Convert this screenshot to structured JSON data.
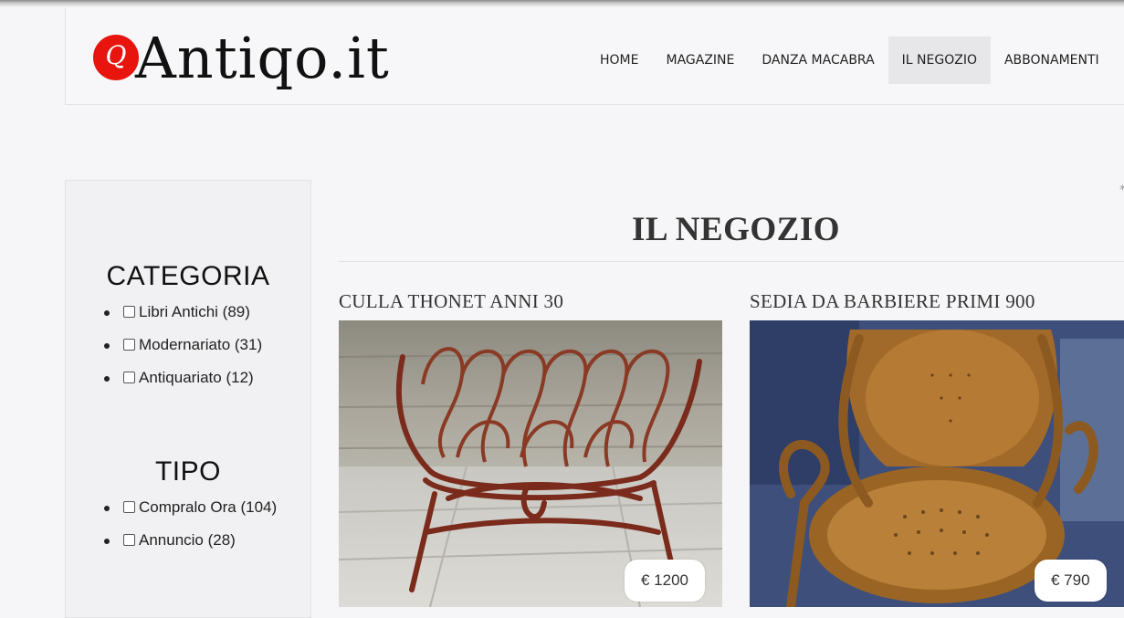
{
  "brand": {
    "logo_letter": "Q",
    "name": "Antiqo.it"
  },
  "nav": {
    "items": [
      {
        "label": "HOME",
        "active": false
      },
      {
        "label": "MAGAZINE",
        "active": false
      },
      {
        "label": "DANZA MACABRA",
        "active": false
      },
      {
        "label": "IL NEGOZIO",
        "active": true
      },
      {
        "label": "ABBONAMENTI",
        "active": false
      }
    ]
  },
  "filters": {
    "categoria": {
      "title": "CATEGORIA",
      "options": [
        {
          "label": "Libri Antichi (89)",
          "checked": false
        },
        {
          "label": "Modernariato (31)",
          "checked": false
        },
        {
          "label": "Antiquariato (12)",
          "checked": false
        }
      ]
    },
    "tipo": {
      "title": "TIPO",
      "options": [
        {
          "label": "Compralo Ora (104)",
          "checked": false
        },
        {
          "label": "Annuncio (28)",
          "checked": false
        }
      ]
    }
  },
  "page": {
    "title": "IL NEGOZIO"
  },
  "products": [
    {
      "name": "CULLA THONET ANNI 30",
      "price": "€ 1200"
    },
    {
      "name": "SEDIA DA BARBIERE PRIMI 900",
      "price": "€ 790"
    }
  ],
  "colors": {
    "logo_red": "#e8150f",
    "nav_active_bg": "#e7e7e9"
  }
}
